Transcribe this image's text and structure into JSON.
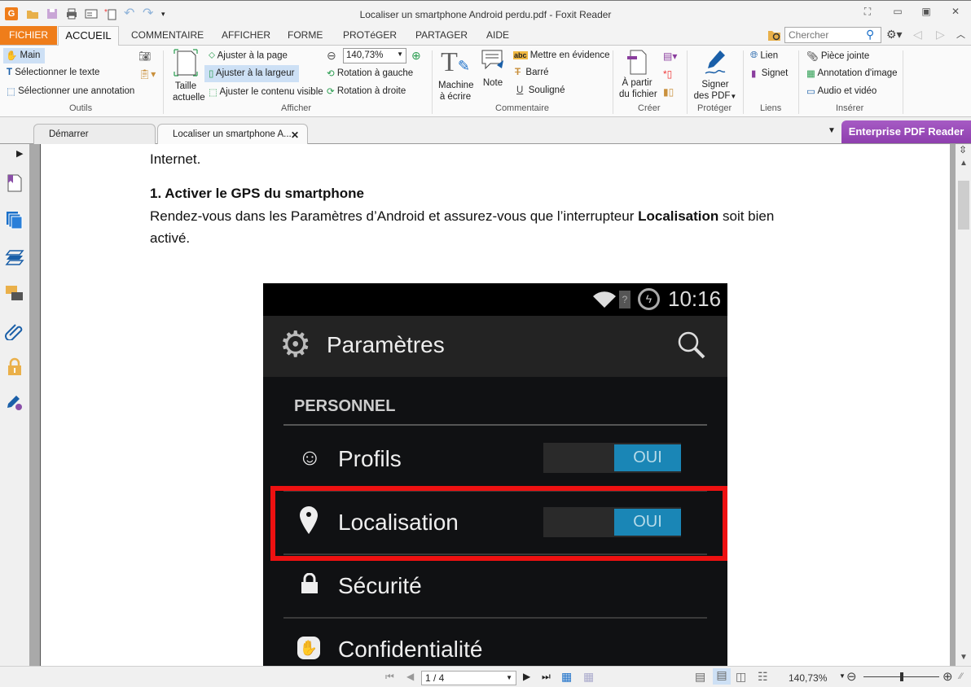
{
  "window": {
    "title": "Localiser un smartphone Android perdu.pdf - Foxit Reader",
    "controls": [
      "fullscreen",
      "minimize",
      "restore",
      "close"
    ]
  },
  "quick_access": [
    "foxit-logo",
    "open",
    "save",
    "print",
    "email",
    "new",
    "undo",
    "redo",
    "customize"
  ],
  "menu_tabs": [
    {
      "label": "FICHIER",
      "state": "file"
    },
    {
      "label": "ACCUEIL",
      "state": "active"
    },
    {
      "label": "COMMENTAIRE"
    },
    {
      "label": "AFFICHER"
    },
    {
      "label": "FORME"
    },
    {
      "label": "PROTéGER"
    },
    {
      "label": "PARTAGER"
    },
    {
      "label": "AIDE"
    }
  ],
  "search": {
    "placeholder": "Chercher"
  },
  "ribbon": {
    "outils": {
      "group": "Outils",
      "main": "Main",
      "select_text": "Sélectionner le texte",
      "select_annotation": "Sélectionner une annotation"
    },
    "afficher": {
      "group": "Afficher",
      "actual_size_1": "Taille",
      "actual_size_2": "actuelle",
      "fit_page": "Ajuster à la page",
      "fit_width": "Ajuster à la largeur",
      "fit_visible": "Ajuster le contenu visible",
      "zoom_value": "140,73%",
      "rotate_left": "Rotation à gauche",
      "rotate_right": "Rotation à droite"
    },
    "commentaire": {
      "group": "Commentaire",
      "typewriter_1": "Machine",
      "typewriter_2": "à écrire",
      "note": "Note",
      "highlight": "Mettre en évidence",
      "strikeout": "Barré",
      "underline": "Souligné"
    },
    "creer": {
      "group": "Créer",
      "from_file_1": "À partir",
      "from_file_2": "du fichier"
    },
    "proteger": {
      "group": "Protéger",
      "sign_1": "Signer",
      "sign_2": "des PDF"
    },
    "liens": {
      "group": "Liens",
      "link": "Lien",
      "bookmark": "Signet"
    },
    "inserer": {
      "group": "Insérer",
      "attachment": "Pièce jointe",
      "image_annotation": "Annotation d'image",
      "audio_video": "Audio et vidéo"
    }
  },
  "doc_tabs": [
    {
      "label": "Démarrer"
    },
    {
      "label": "Localiser un smartphone A...",
      "active": true
    }
  ],
  "enterprise_banner": "Enterprise PDF Reader",
  "left_panel_icons": [
    "bookmark-icon",
    "pages-icon",
    "layers-icon",
    "comments-icon",
    "attachments-icon",
    "security-icon",
    "signature-icon"
  ],
  "document": {
    "line1": "Internet.",
    "heading": "1. Activer le GPS du smartphone",
    "para_part1": "Rendez-vous dans les Paramètres d’Android et assurez-vous que l’interrupteur ",
    "para_bold": "Localisation",
    "para_part2": " soit bien",
    "para_line2": "activé."
  },
  "phone": {
    "time": "10:16",
    "app_title": "Paramètres",
    "section": "PERSONNEL",
    "rows": [
      {
        "label": "Profils",
        "toggle": "OUI"
      },
      {
        "label": "Localisation",
        "toggle": "OUI",
        "highlighted": true
      },
      {
        "label": "Sécurité"
      },
      {
        "label": "Confidentialité"
      }
    ]
  },
  "statusbar": {
    "page": "1 / 4",
    "zoom": "140,73%",
    "zoom_slider_fraction": 0.35
  },
  "colors": {
    "fichier_tab": "#ef7d1a",
    "enterprise": "#9a4cba",
    "highlight_box": "#ee1111",
    "toggle_on": "#1a86b6"
  }
}
